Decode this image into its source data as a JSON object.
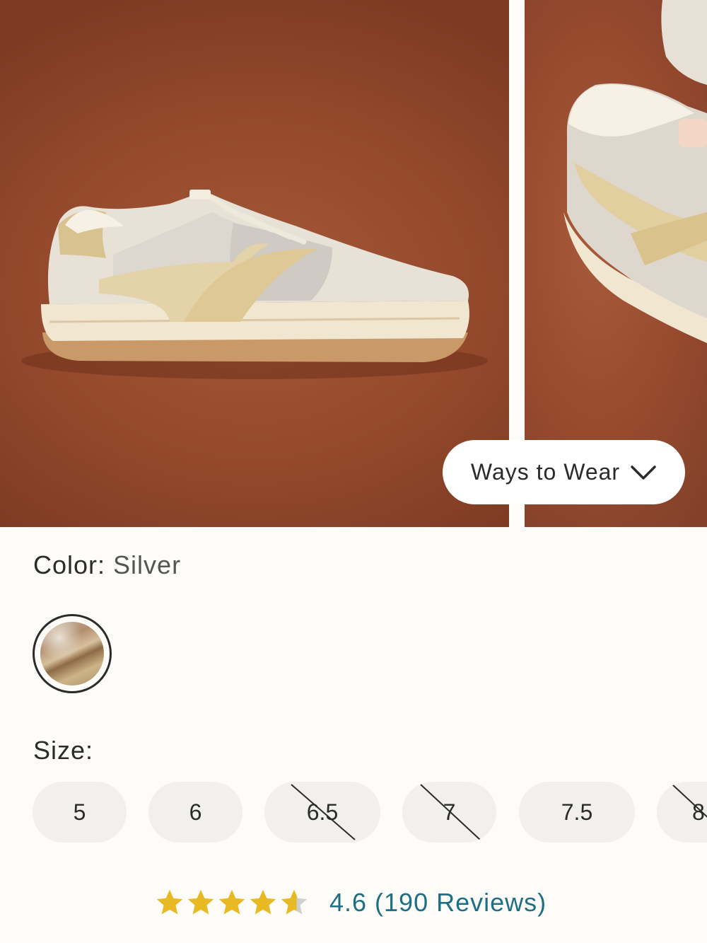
{
  "gallery": {
    "ways_to_wear_label": "Ways to Wear",
    "background_color": "#94492c"
  },
  "color": {
    "label": "Color:",
    "value": "Silver"
  },
  "size": {
    "label": "Size:",
    "options": [
      {
        "label": "5",
        "available": true
      },
      {
        "label": "6",
        "available": true
      },
      {
        "label": "6.5",
        "available": false
      },
      {
        "label": "7",
        "available": false
      },
      {
        "label": "7.5",
        "available": true
      },
      {
        "label": "8",
        "available": false
      }
    ]
  },
  "rating": {
    "stars": 4.6,
    "max_stars": 5,
    "text": "4.6 (190 Reviews)",
    "star_color": "#e8b923"
  }
}
